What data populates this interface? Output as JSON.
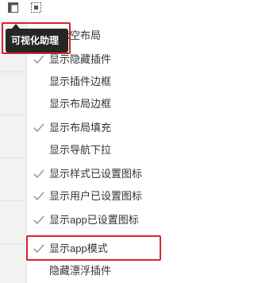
{
  "tooltip": {
    "text": "可视化助理"
  },
  "menu": {
    "items": [
      {
        "label": "显示空布局",
        "checked": false
      },
      {
        "label": "显示隐藏插件",
        "checked": true
      },
      {
        "label": "显示插件边框",
        "checked": false
      },
      {
        "label": "显示布局边框",
        "checked": false
      },
      {
        "label": "显示布局填充",
        "checked": true
      },
      {
        "label": "显示导航下拉",
        "checked": false
      },
      {
        "label": "显示样式已设置图标",
        "checked": true
      },
      {
        "label": "显示用户已设置图标",
        "checked": true
      },
      {
        "label": "显示app已设置图标",
        "checked": true
      },
      {
        "label": "显示app模式",
        "checked": true
      },
      {
        "label": "隐藏漂浮插件",
        "checked": false
      }
    ]
  },
  "colors": {
    "highlight": "#d7232e",
    "tooltip_bg": "#262626",
    "check": "#9a9a9a"
  },
  "icons": {
    "toolbar": [
      "layout-panel-icon",
      "visual-assistant-icon"
    ],
    "item_check": "check-icon"
  }
}
